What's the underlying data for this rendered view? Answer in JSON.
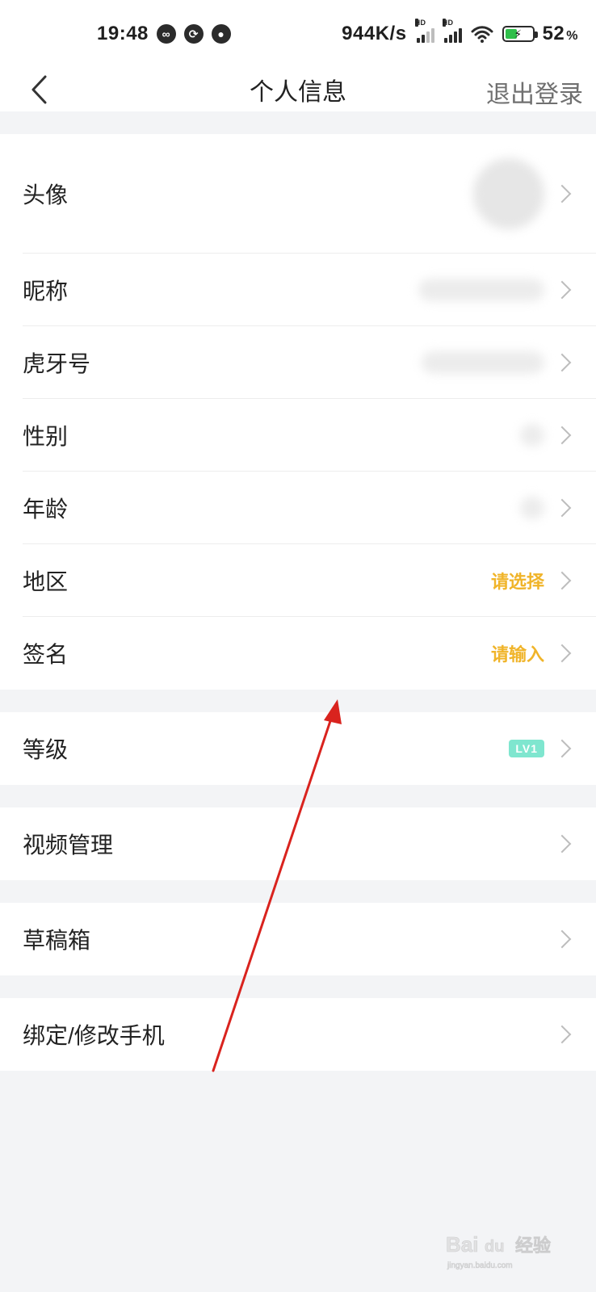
{
  "status_bar": {
    "time": "19:48",
    "network_speed": "944K/s",
    "hd_1": "HD",
    "hd_2": "HD",
    "battery_percent": "52",
    "battery_percent_sign": "%",
    "battery_level": 0.52,
    "colors": {
      "battery_fill": "#2fbf4a"
    }
  },
  "header": {
    "title": "个人信息",
    "back_icon": "chevron-left-icon",
    "logout_label": "退出登录"
  },
  "sections": [
    {
      "rows": [
        {
          "label": "头像",
          "type": "avatar"
        },
        {
          "label": "昵称",
          "type": "blur"
        },
        {
          "label": "虎牙号",
          "type": "blur"
        },
        {
          "label": "性别",
          "type": "blur"
        },
        {
          "label": "年龄",
          "type": "blur"
        },
        {
          "label": "地区",
          "type": "value",
          "value": "请选择"
        },
        {
          "label": "签名",
          "type": "value",
          "value": "请输入"
        }
      ]
    },
    {
      "rows": [
        {
          "label": "等级",
          "type": "badge",
          "badge": "LV1"
        }
      ]
    },
    {
      "rows": [
        {
          "label": "视频管理",
          "type": "none"
        }
      ]
    },
    {
      "rows": [
        {
          "label": "草稿箱",
          "type": "none"
        }
      ]
    },
    {
      "rows": [
        {
          "label": "绑定/修改手机",
          "type": "none"
        }
      ]
    }
  ],
  "annotation": {
    "color": "#d9231e"
  },
  "watermark": {
    "brand_en": "Bai",
    "brand_paw": "du",
    "brand_cn": "经验",
    "site": "jingyan.baidu.com"
  },
  "colors": {
    "accent": "#f0b429",
    "level_badge": "#7fe6cf",
    "background": "#f3f4f6",
    "card": "#ffffff"
  }
}
